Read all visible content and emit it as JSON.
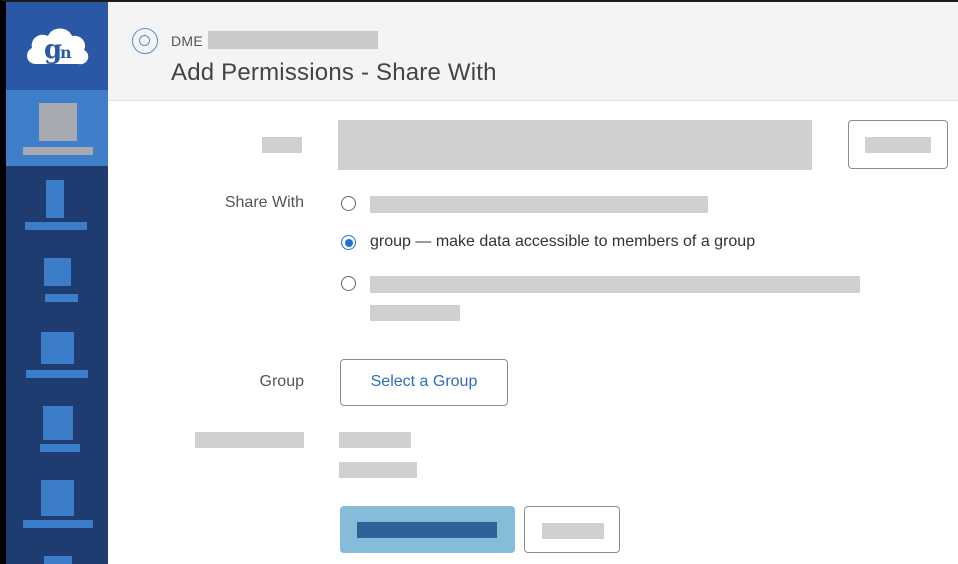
{
  "app": {
    "logo": "globus-cloud-logo",
    "colors": {
      "sidebar": "#1f3c70",
      "sidebar_logo_bg": "#2b58a4",
      "sidebar_active": "#3f7ec9",
      "header_bg": "#f4f4f4",
      "link": "#2a6fb8",
      "primary_button": "#86bbd9",
      "radio_selected": "#1e73d2"
    }
  },
  "sidebar": {
    "items": [
      {
        "icon": "redacted-nav-icon",
        "active": true
      },
      {
        "icon": "redacted-nav-icon",
        "active": false
      },
      {
        "icon": "redacted-nav-icon",
        "active": false
      },
      {
        "icon": "redacted-nav-icon",
        "active": false
      },
      {
        "icon": "redacted-nav-icon",
        "active": false
      },
      {
        "icon": "redacted-nav-icon",
        "active": false
      },
      {
        "icon": "redacted-nav-icon",
        "active": false
      }
    ]
  },
  "header": {
    "endpoint_icon": "endpoint-ring-icon",
    "endpoint_prefix": "DME",
    "title": "Add Permissions - Share With"
  },
  "form": {
    "share_with": {
      "label": "Share With",
      "options": [
        {
          "text": "",
          "checked": false
        },
        {
          "text": "group — make data accessible to members of a group",
          "checked": true
        },
        {
          "text": "",
          "checked": false
        }
      ]
    },
    "group": {
      "label": "Group",
      "select_button": "Select a Group"
    }
  }
}
